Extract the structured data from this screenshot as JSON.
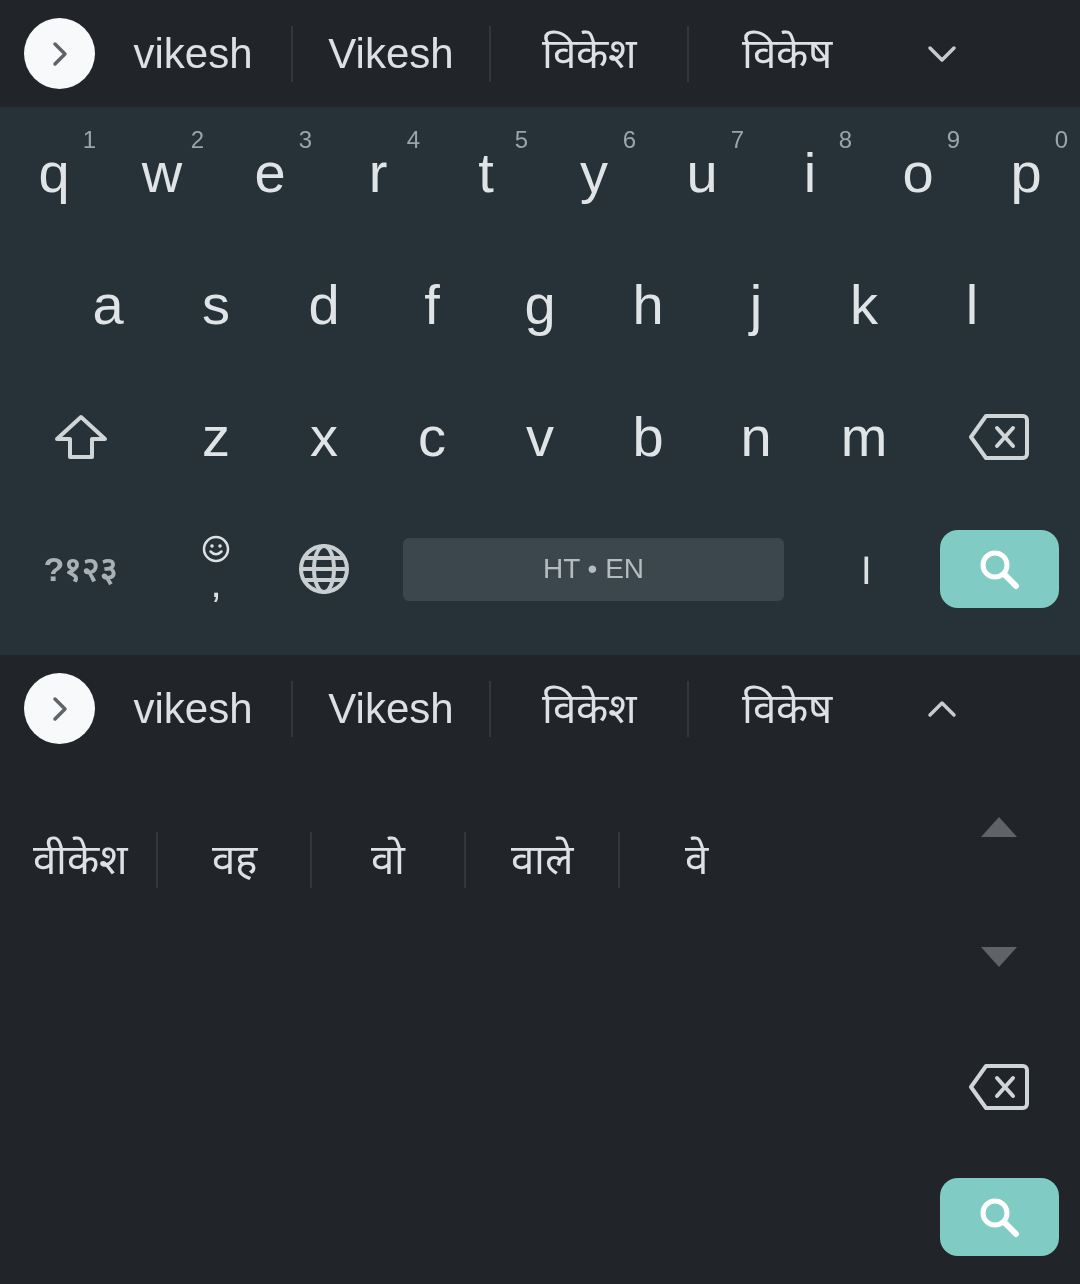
{
  "keyboard_view": {
    "suggestion_bar": {
      "suggestions": [
        "vikesh",
        "Vikesh",
        "विकेश",
        "विकेष"
      ],
      "expanded": false
    },
    "rows": [
      [
        {
          "kind": "letter",
          "label": "q",
          "hint": "1"
        },
        {
          "kind": "letter",
          "label": "w",
          "hint": "2"
        },
        {
          "kind": "letter",
          "label": "e",
          "hint": "3"
        },
        {
          "kind": "letter",
          "label": "r",
          "hint": "4"
        },
        {
          "kind": "letter",
          "label": "t",
          "hint": "5"
        },
        {
          "kind": "letter",
          "label": "y",
          "hint": "6"
        },
        {
          "kind": "letter",
          "label": "u",
          "hint": "7"
        },
        {
          "kind": "letter",
          "label": "i",
          "hint": "8"
        },
        {
          "kind": "letter",
          "label": "o",
          "hint": "9"
        },
        {
          "kind": "letter",
          "label": "p",
          "hint": "0"
        }
      ],
      [
        {
          "kind": "letter",
          "label": "a"
        },
        {
          "kind": "letter",
          "label": "s"
        },
        {
          "kind": "letter",
          "label": "d"
        },
        {
          "kind": "letter",
          "label": "f"
        },
        {
          "kind": "letter",
          "label": "g"
        },
        {
          "kind": "letter",
          "label": "h"
        },
        {
          "kind": "letter",
          "label": "j"
        },
        {
          "kind": "letter",
          "label": "k"
        },
        {
          "kind": "letter",
          "label": "l"
        }
      ],
      [
        {
          "kind": "shift"
        },
        {
          "kind": "letter",
          "label": "z"
        },
        {
          "kind": "letter",
          "label": "x"
        },
        {
          "kind": "letter",
          "label": "c"
        },
        {
          "kind": "letter",
          "label": "v"
        },
        {
          "kind": "letter",
          "label": "b"
        },
        {
          "kind": "letter",
          "label": "n"
        },
        {
          "kind": "letter",
          "label": "m"
        },
        {
          "kind": "backspace"
        }
      ]
    ],
    "bottom_row": [
      {
        "kind": "symbols",
        "label": "?१२३"
      },
      {
        "kind": "emoji_comma",
        "label": ","
      },
      {
        "kind": "globe"
      },
      {
        "kind": "space",
        "label": "HT • EN"
      },
      {
        "kind": "danda",
        "label": "।"
      },
      {
        "kind": "search"
      }
    ]
  },
  "expanded_view": {
    "suggestion_bar": {
      "suggestions": [
        "vikesh",
        "Vikesh",
        "विकेश",
        "विकेष"
      ],
      "expanded": true
    },
    "more_suggestions": [
      "वीकेश",
      "वह",
      "वो",
      "वाले",
      "वे"
    ],
    "side_keys": [
      {
        "kind": "scroll_up"
      },
      {
        "kind": "scroll_down"
      },
      {
        "kind": "backspace"
      },
      {
        "kind": "search"
      }
    ]
  }
}
